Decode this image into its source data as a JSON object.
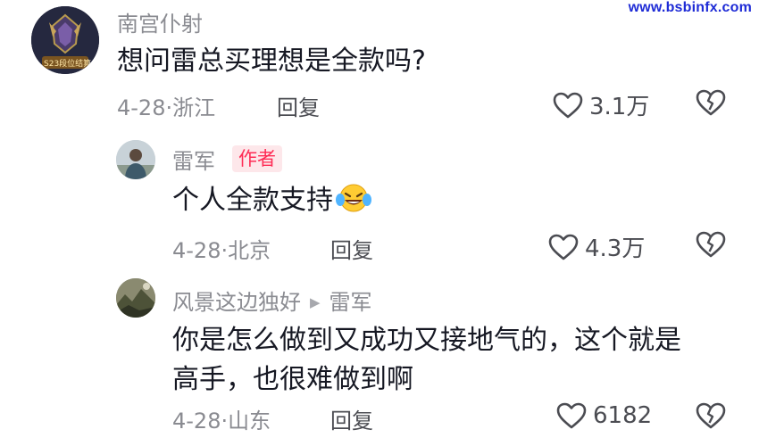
{
  "watermark": "www.bsbinfx.com",
  "comments": [
    {
      "username": "南宫仆射",
      "avatar_badge_text": "S23段位结算",
      "text": "想问雷总买理想是全款吗?",
      "date": "4-28",
      "location": "浙江",
      "reply_label": "回复",
      "likes": "3.1万",
      "avatar_icon": "game-rank-avatar"
    },
    {
      "username": "雷军",
      "author_badge": "作者",
      "text": "个人全款支持",
      "emoji": "laughing-crying-emoji",
      "date": "4-28",
      "location": "北京",
      "reply_label": "回复",
      "likes": "4.3万",
      "avatar_icon": "person-photo-avatar"
    },
    {
      "username": "风景这边独好",
      "reply_to": "雷军",
      "text_line1": "你是怎么做到又成功又接地气的，这个就是",
      "text_line2": "高手，也很难做到啊",
      "date": "4-28",
      "location": "山东",
      "reply_label": "回复",
      "likes": "6182",
      "avatar_icon": "landscape-avatar"
    }
  ],
  "colors": {
    "primary_text": "#161823",
    "secondary_text": "#8a8b91",
    "author_badge": "#fe2c55",
    "watermark": "#1e2bd6"
  }
}
